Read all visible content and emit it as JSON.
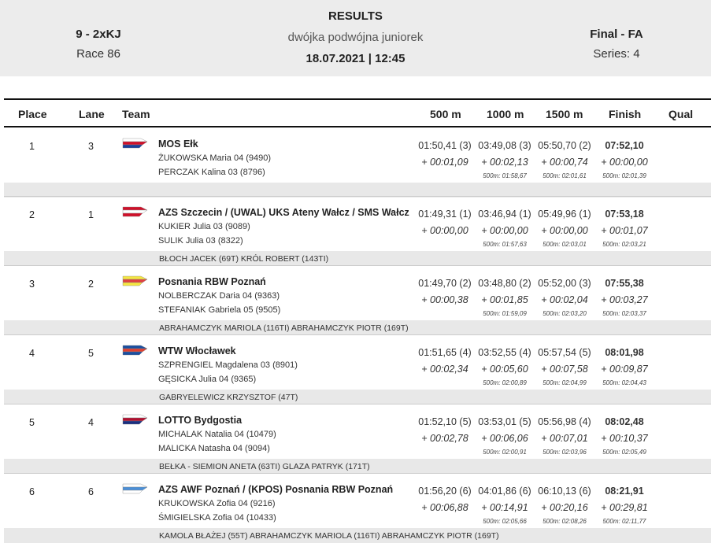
{
  "header": {
    "event_code": "9 - 2xKJ",
    "race": "Race 86",
    "title": "RESULTS",
    "subtitle": "dwójka podwójna juniorek",
    "datetime": "18.07.2021 | 12:45",
    "phase": "Final - FA",
    "series": "Series: 4"
  },
  "columns": {
    "place": "Place",
    "lane": "Lane",
    "team": "Team",
    "c500": "500 m",
    "c1000": "1000 m",
    "c1500": "1500 m",
    "finish": "Finish",
    "qual": "Qual"
  },
  "rows": [
    {
      "place": "1",
      "lane": "3",
      "club": "MOS Ełk",
      "crew1": "ŻUKOWSKA  Maria 04 (9490)",
      "crew2": "PERCZAK  Kalina 03 (8796)",
      "t500": "01:50,41 (3)",
      "d500": "+ 00:01,09",
      "t1000": "03:49,08 (3)",
      "d1000": "+ 00:02,13",
      "s1000": "500m: 01:58,67",
      "t1500": "05:50,70 (2)",
      "d1500": "+ 00:00,74",
      "s1500": "500m: 02:01,61",
      "tfin": "07:52,10",
      "dfin": "+ 00:00,00",
      "sfin": "500m: 02:01,39",
      "coach": ""
    },
    {
      "place": "2",
      "lane": "1",
      "club": "AZS Szczecin / (UWAL) UKS Ateny Wałcz / SMS Wałcz",
      "crew1": "KUKIER  Julia 03 (9089)",
      "crew2": "SULIK  Julia 03 (8322)",
      "t500": "01:49,31 (1)",
      "d500": "+ 00:00,00",
      "t1000": "03:46,94 (1)",
      "d1000": "+ 00:00,00",
      "s1000": "500m: 01:57,63",
      "t1500": "05:49,96 (1)",
      "d1500": "+ 00:00,00",
      "s1500": "500m: 02:03,01",
      "tfin": "07:53,18",
      "dfin": "+ 00:01,07",
      "sfin": "500m: 02:03,21",
      "coach": "BŁOCH JACEK (69T) KRÓL ROBERT (143TI)"
    },
    {
      "place": "3",
      "lane": "2",
      "club": "Posnania RBW Poznań",
      "crew1": "NOLBERCZAK  Daria 04 (9363)",
      "crew2": "STEFANIAK  Gabriela 05 (9505)",
      "t500": "01:49,70 (2)",
      "d500": "+ 00:00,38",
      "t1000": "03:48,80 (2)",
      "d1000": "+ 00:01,85",
      "s1000": "500m: 01:59,09",
      "t1500": "05:52,00 (3)",
      "d1500": "+ 00:02,04",
      "s1500": "500m: 02:03,20",
      "tfin": "07:55,38",
      "dfin": "+ 00:03,27",
      "sfin": "500m: 02:03,37",
      "coach": "ABRAHAMCZYK MARIOLA (116TI) ABRAHAMCZYK PIOTR (169T)"
    },
    {
      "place": "4",
      "lane": "5",
      "club": "WTW Włocławek",
      "crew1": "SZPRENGIEL  Magdalena 03 (8901)",
      "crew2": "GĘSICKA  Julia 04 (9365)",
      "t500": "01:51,65 (4)",
      "d500": "+ 00:02,34",
      "t1000": "03:52,55 (4)",
      "d1000": "+ 00:05,60",
      "s1000": "500m: 02:00,89",
      "t1500": "05:57,54 (5)",
      "d1500": "+ 00:07,58",
      "s1500": "500m: 02:04,99",
      "tfin": "08:01,98",
      "dfin": "+ 00:09,87",
      "sfin": "500m: 02:04,43",
      "coach": "GABRYELEWICZ KRZYSZTOF (47T)"
    },
    {
      "place": "5",
      "lane": "4",
      "club": "LOTTO Bydgostia",
      "crew1": "MICHALAK  Natalia 04 (10479)",
      "crew2": "MALICKA  Natasha 04 (9094)",
      "t500": "01:52,10 (5)",
      "d500": "+ 00:02,78",
      "t1000": "03:53,01 (5)",
      "d1000": "+ 00:06,06",
      "s1000": "500m: 02:00,91",
      "t1500": "05:56,98 (4)",
      "d1500": "+ 00:07,01",
      "s1500": "500m: 02:03,96",
      "tfin": "08:02,48",
      "dfin": "+ 00:10,37",
      "sfin": "500m: 02:05,49",
      "coach": "BEŁKA - SIEMION ANETA (63TI) GLAZA PATRYK (171T)"
    },
    {
      "place": "6",
      "lane": "6",
      "club": "AZS AWF Poznań / (KPOS) Posnania RBW Poznań",
      "crew1": "KRUKOWSKA  Zofia 04 (9216)",
      "crew2": "ŚMIGIELSKA  Zofia 04 (10433)",
      "t500": "01:56,20 (6)",
      "d500": "+ 00:06,88",
      "t1000": "04:01,86 (6)",
      "d1000": "+ 00:14,91",
      "s1000": "500m: 02:05,66",
      "t1500": "06:10,13 (6)",
      "d1500": "+ 00:20,16",
      "s1500": "500m: 02:08,26",
      "tfin": "08:21,91",
      "dfin": "+ 00:29,81",
      "sfin": "500m: 02:11,77",
      "coach": "KAMOLA BŁAŻEJ (55T) ABRAHAMCZYK MARIOLA (116TI) ABRAHAMCZYK PIOTR (169T)"
    }
  ],
  "flags": [
    {
      "icon": "flag-mos-elk-icon",
      "colors": [
        "#ffffff",
        "#d0102a",
        "#1a3f9a"
      ]
    },
    {
      "icon": "flag-azs-szczecin-icon",
      "colors": [
        "#d0102a",
        "#ffffff",
        "#d0102a"
      ]
    },
    {
      "icon": "flag-posnania-icon",
      "colors": [
        "#f5e642",
        "#e04040",
        "#f5e642"
      ]
    },
    {
      "icon": "flag-wtw-icon",
      "colors": [
        "#1a4fa0",
        "#e04030",
        "#1a4fa0"
      ]
    },
    {
      "icon": "flag-lotto-bydgostia-icon",
      "colors": [
        "#ffffff",
        "#b01030",
        "#1a2f80"
      ]
    },
    {
      "icon": "flag-azs-awf-icon",
      "colors": [
        "#ffffff",
        "#4a8fd8",
        "#ffffff"
      ]
    }
  ]
}
